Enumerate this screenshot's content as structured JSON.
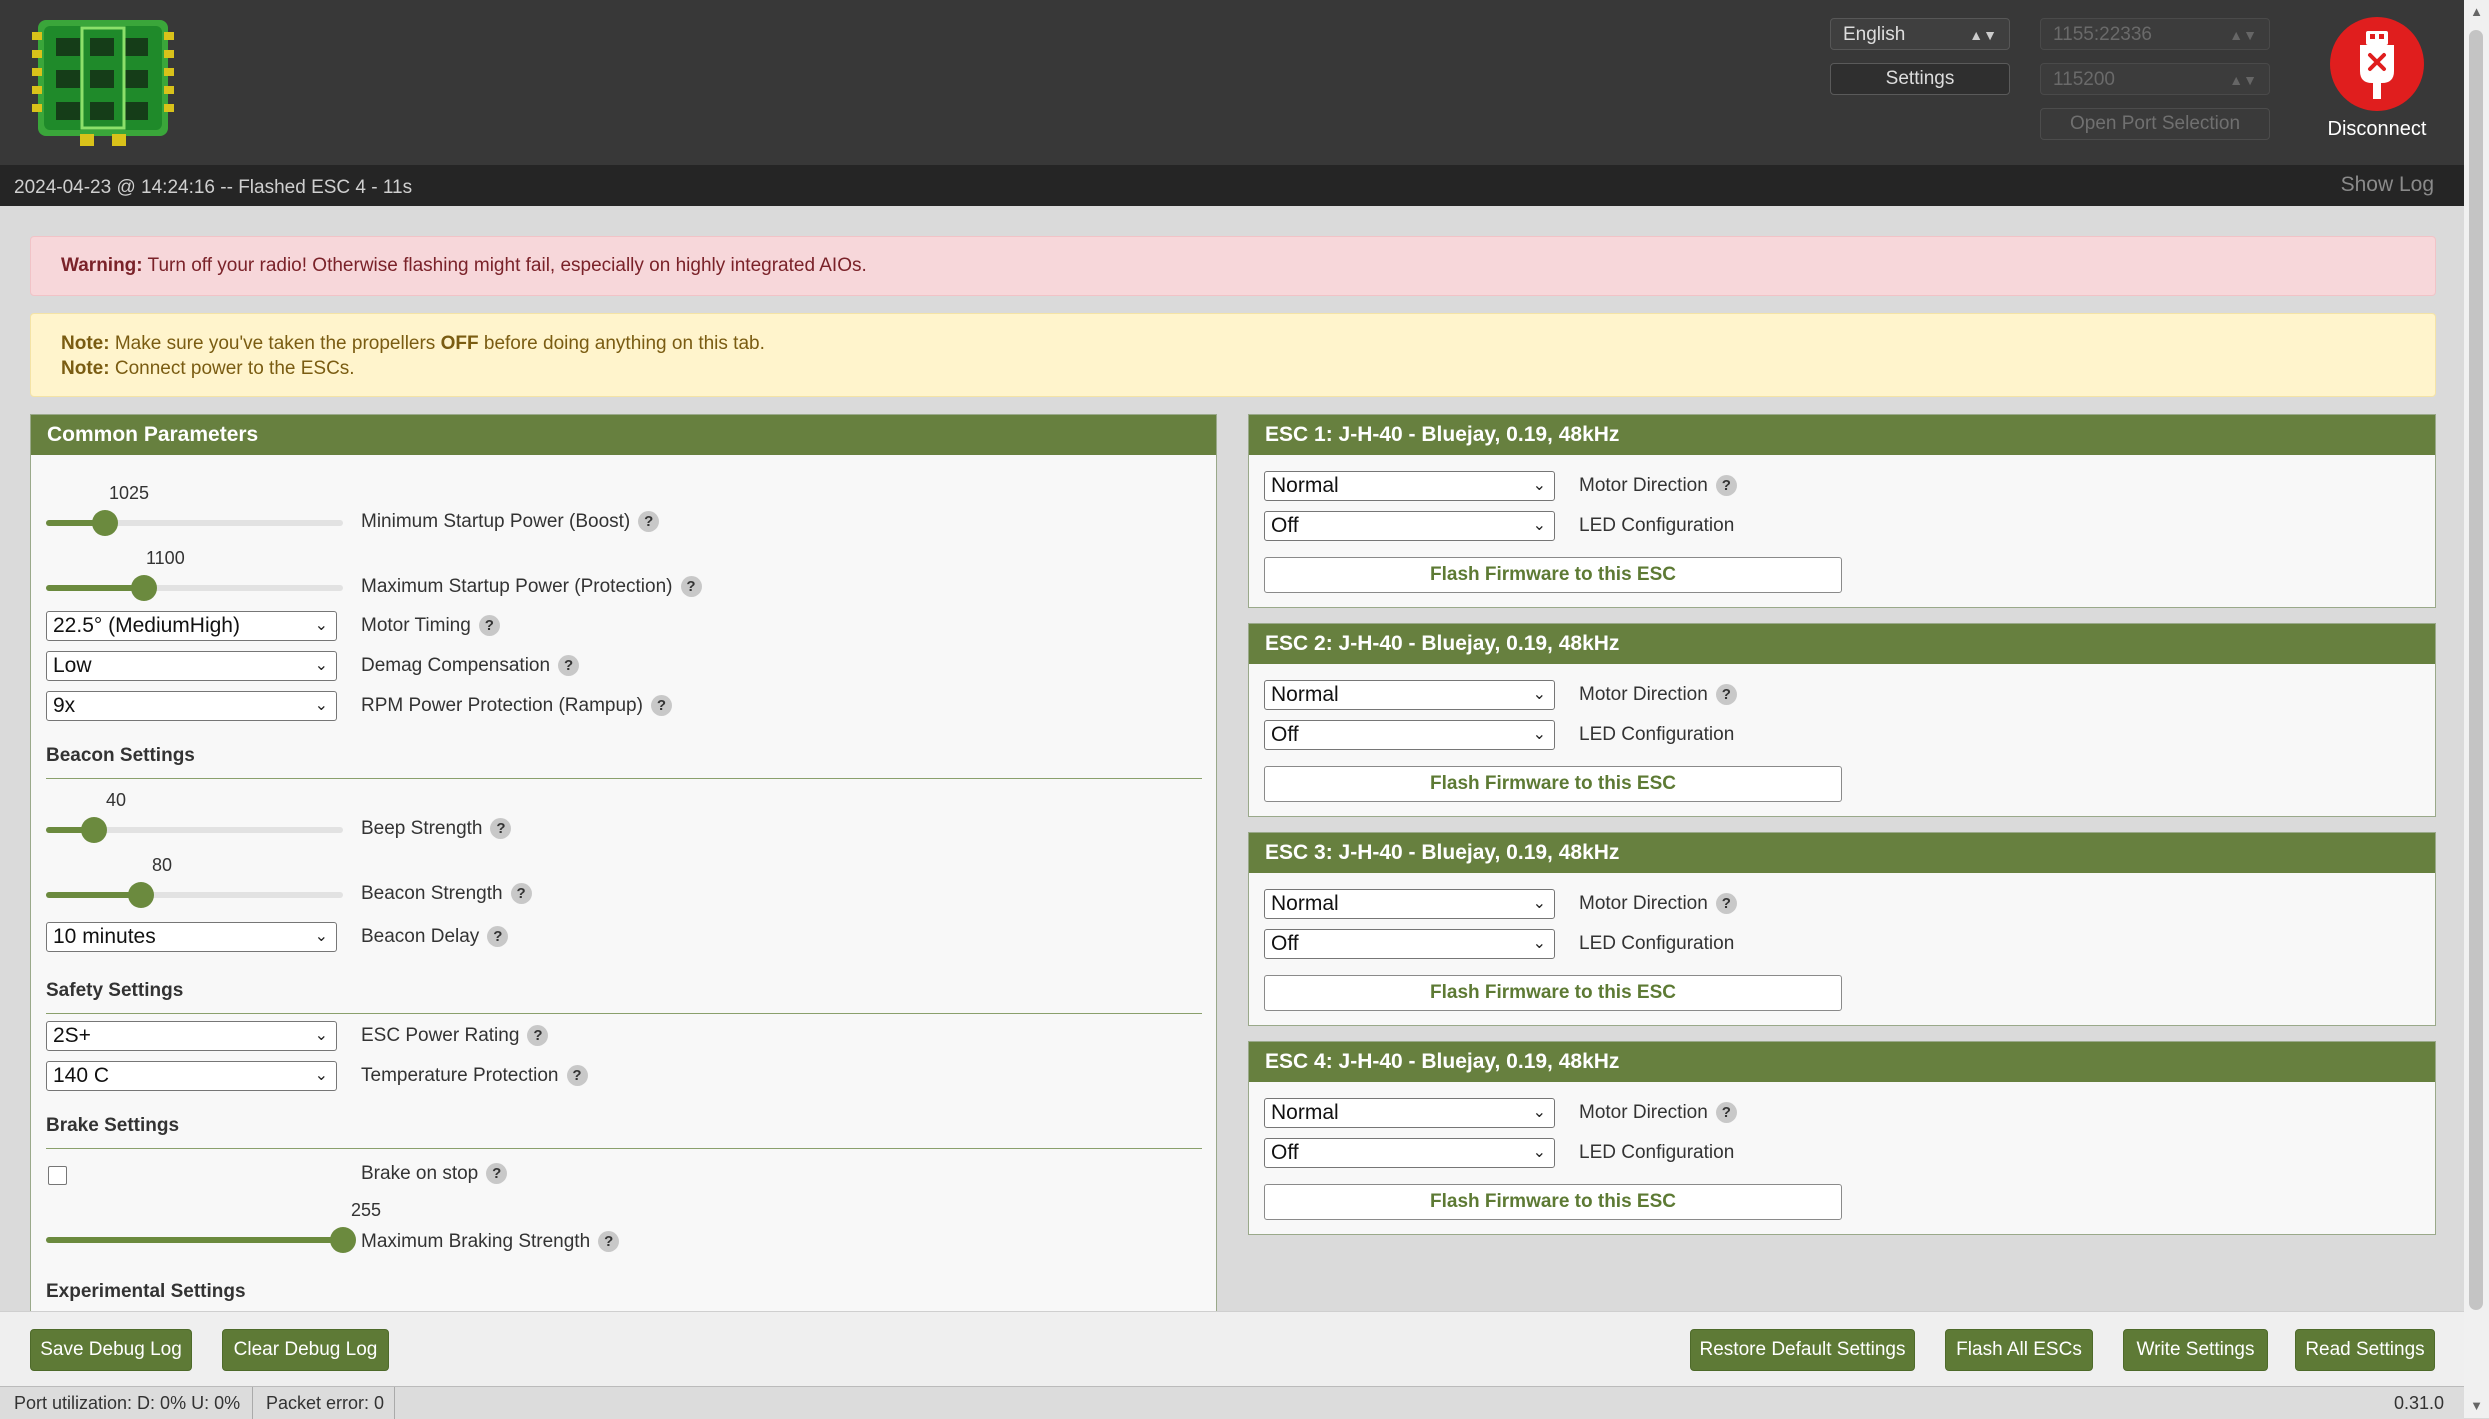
{
  "header": {
    "language": "English",
    "settings_label": "Settings",
    "port": "1155:22336",
    "baud": "115200",
    "open_port_label": "Open Port Selection",
    "disconnect_label": "Disconnect"
  },
  "status": {
    "log_line": "2024-04-23 @ 14:24:16 -- Flashed ESC 4 - 11s",
    "show_log": "Show Log"
  },
  "warning": {
    "strong": "Warning:",
    "text": " Turn off your radio! Otherwise flashing might fail, especially on highly integrated AIOs."
  },
  "notes": {
    "note_label": "Note:",
    "line1_a": " Make sure you've taken the propellers ",
    "line1_b": "OFF",
    "line1_c": " before doing anything on this tab.",
    "line2": " Connect power to the ESCs."
  },
  "common": {
    "title": "Common Parameters",
    "min_startup": {
      "label": "Minimum Startup Power (Boost)",
      "value": "1025",
      "fraction": 0.2
    },
    "max_startup": {
      "label": "Maximum Startup Power (Protection)",
      "value": "1100",
      "fraction": 0.33
    },
    "motor_timing": {
      "label": "Motor Timing",
      "value": "22.5° (MediumHigh)"
    },
    "demag": {
      "label": "Demag Compensation",
      "value": "Low"
    },
    "rampup": {
      "label": "RPM Power Protection (Rampup)",
      "value": "9x"
    },
    "beacon_title": "Beacon Settings",
    "beep_strength": {
      "label": "Beep Strength",
      "value": "40",
      "fraction": 0.16
    },
    "beacon_strength": {
      "label": "Beacon Strength",
      "value": "80",
      "fraction": 0.32
    },
    "beacon_delay": {
      "label": "Beacon Delay",
      "value": "10 minutes"
    },
    "safety_title": "Safety Settings",
    "power_rating": {
      "label": "ESC Power Rating",
      "value": "2S+"
    },
    "temp_protection": {
      "label": "Temperature Protection",
      "value": "140 C"
    },
    "brake_title": "Brake Settings",
    "brake_on_stop": {
      "label": "Brake on stop",
      "checked": false
    },
    "max_braking": {
      "label": "Maximum Braking Strength",
      "value": "255",
      "fraction": 1.0
    },
    "experimental_title": "Experimental Settings"
  },
  "escs": [
    {
      "title": "ESC 1: J-H-40 - Bluejay, 0.19, 48kHz",
      "direction": "Normal",
      "led": "Off"
    },
    {
      "title": "ESC 2: J-H-40 - Bluejay, 0.19, 48kHz",
      "direction": "Normal",
      "led": "Off"
    },
    {
      "title": "ESC 3: J-H-40 - Bluejay, 0.19, 48kHz",
      "direction": "Normal",
      "led": "Off"
    },
    {
      "title": "ESC 4: J-H-40 - Bluejay, 0.19, 48kHz",
      "direction": "Normal",
      "led": "Off"
    }
  ],
  "esc_labels": {
    "direction": "Motor Direction",
    "led": "LED Configuration",
    "flash": "Flash Firmware to this ESC"
  },
  "toolbar": {
    "save_debug": "Save Debug Log",
    "clear_debug": "Clear Debug Log",
    "restore": "Restore Default Settings",
    "flash_all": "Flash All ESCs",
    "write": "Write Settings",
    "read": "Read Settings"
  },
  "footer": {
    "port_util": "Port utilization: D: 0% U: 0%",
    "packet_error": "Packet error: 0",
    "version": "0.31.0"
  },
  "colors": {
    "accent_green": "#67803f",
    "disconnect_red": "#e01e1e",
    "header_bg": "#383838"
  }
}
